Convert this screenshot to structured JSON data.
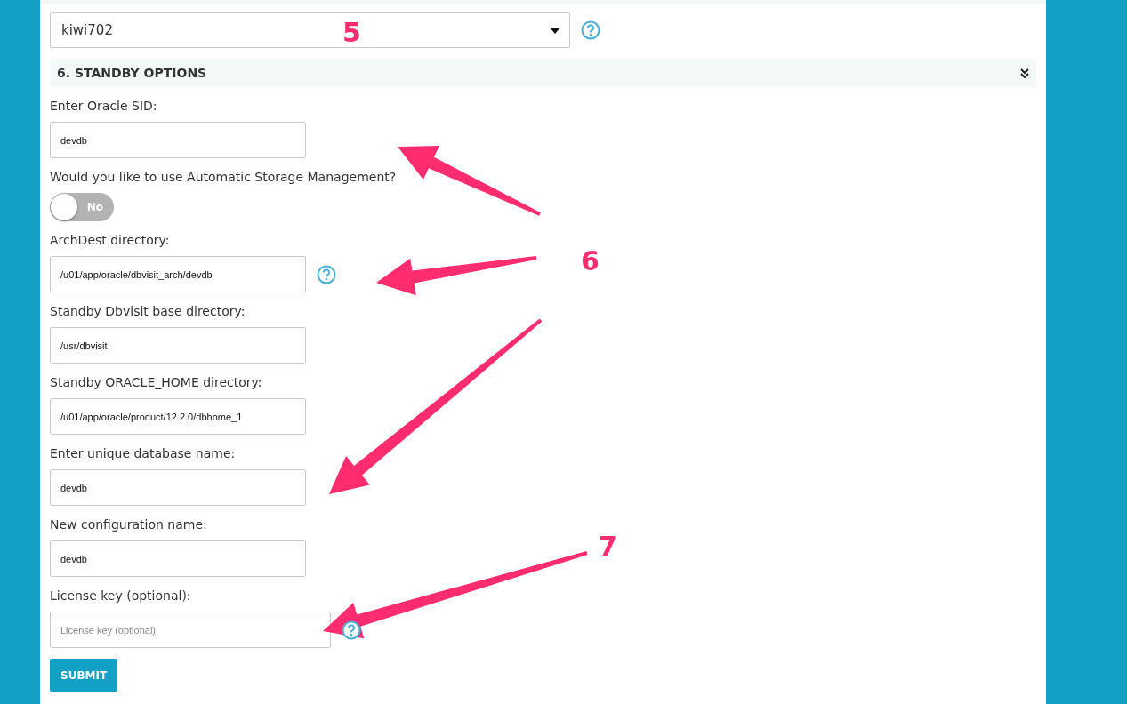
{
  "host_select": {
    "value": "kiwi702",
    "help": true
  },
  "section": {
    "title": "6. STANDBY OPTIONS",
    "expanded": true
  },
  "fields": [
    {
      "kind": "text",
      "label": "Enter Oracle SID:",
      "value": "devdb",
      "help": false
    },
    {
      "kind": "toggle",
      "label": "Would you like to use Automatic Storage Management?",
      "on": false,
      "text": "No"
    },
    {
      "kind": "text",
      "label": "ArchDest directory:",
      "value": "/u01/app/oracle/dbvisit_arch/devdb",
      "help": true
    },
    {
      "kind": "text",
      "label": "Standby Dbvisit base directory:",
      "value": "/usr/dbvisit",
      "help": false
    },
    {
      "kind": "text",
      "label": "Standby ORACLE_HOME directory:",
      "value": "/u01/app/oracle/product/12.2.0/dbhome_1",
      "help": false
    },
    {
      "kind": "text",
      "label": "Enter unique database name:",
      "value": "devdb",
      "help": false
    },
    {
      "kind": "text",
      "label": "New configuration name:",
      "value": "devdb",
      "help": false
    },
    {
      "kind": "text",
      "label": "License key (optional):",
      "placeholder": "License key (optional)",
      "help": true,
      "wide": true
    }
  ],
  "submit": "SUBMIT",
  "callouts": [
    "5",
    "6",
    "7"
  ]
}
